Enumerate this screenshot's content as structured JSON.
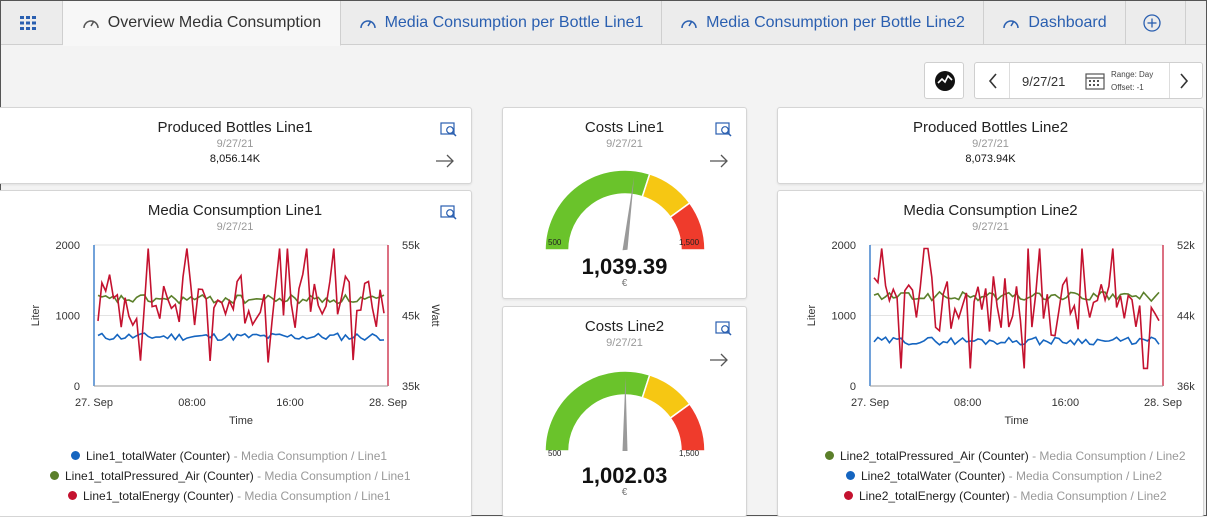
{
  "tabs": [
    {
      "label": ""
    },
    {
      "label": "Overview Media Consumption"
    },
    {
      "label": "Media Consumption per Bottle Line1"
    },
    {
      "label": "Media Consumption per Bottle Line2"
    },
    {
      "label": "Dashboard"
    },
    {
      "label": ""
    }
  ],
  "toolbar": {
    "date": "9/27/21",
    "range": "Range: Day",
    "offset": "Offset: -1"
  },
  "kpi1": {
    "title": "Produced Bottles Line1",
    "date": "9/27/21",
    "value": "8,056.14K"
  },
  "kpi2": {
    "title": "Produced Bottles Line2",
    "date": "9/27/21",
    "value": "8,073.94K"
  },
  "gauge1": {
    "title": "Costs Line1",
    "date": "9/27/21",
    "min": "500",
    "max": "1,500",
    "value": "1,039.39",
    "unit": "€",
    "reading": 1039.39
  },
  "gauge2": {
    "title": "Costs Line2",
    "date": "9/27/21",
    "min": "500",
    "max": "1,500",
    "value": "1,002.03",
    "unit": "€",
    "reading": 1002.03
  },
  "chart1": {
    "title": "Media Consumption Line1",
    "date": "9/27/21",
    "y_left_label": "Liter",
    "y_right_label": "Watt",
    "x_label": "Time",
    "left_ticks": [
      "2000",
      "1000",
      "0"
    ],
    "right_ticks": [
      "55k",
      "45k",
      "35k"
    ],
    "x_ticks": [
      "27. Sep",
      "08:00",
      "16:00",
      "28. Sep"
    ],
    "legend": [
      {
        "name": "Line1_totalWater (Counter)",
        "src": " - Media Consumption / Line1",
        "color": "#1565c0"
      },
      {
        "name": "Line1_totalPressured_Air (Counter)",
        "src": " - Media Consumption / Line1",
        "color": "#5b7f2a"
      },
      {
        "name": "Line1_totalEnergy (Counter)",
        "src": " - Media Consumption / Line1",
        "color": "#c4122f"
      }
    ]
  },
  "chart2": {
    "title": "Media Consumption Line2",
    "date": "9/27/21",
    "y_left_label": "Liter",
    "x_label": "Time",
    "left_ticks": [
      "2000",
      "1000",
      "0"
    ],
    "right_ticks": [
      "52k",
      "44k",
      "36k"
    ],
    "x_ticks": [
      "27. Sep",
      "08:00",
      "16:00",
      "28. Sep"
    ],
    "legend": [
      {
        "name": "Line2_totalPressured_Air (Counter)",
        "src": " - Media Consumption / Line2",
        "color": "#5b7f2a"
      },
      {
        "name": "Line2_totalWater (Counter)",
        "src": " - Media Consumption / Line2",
        "color": "#1565c0"
      },
      {
        "name": "Line2_totalEnergy (Counter)",
        "src": " - Media Consumption / Line2",
        "color": "#c4122f"
      }
    ]
  },
  "chart_data": [
    {
      "type": "line",
      "title": "Media Consumption Line1",
      "xlabel": "Time",
      "ylabel": "Liter",
      "ylim": [
        0,
        2000
      ],
      "y2label": "Watt",
      "y2lim": [
        "35k",
        "55k"
      ],
      "x": [
        "27. Sep",
        "08:00",
        "16:00",
        "28. Sep"
      ],
      "series": [
        {
          "name": "Line1_totalWater (Counter)",
          "axis": "left",
          "approx_level": 700
        },
        {
          "name": "Line1_totalPressured_Air (Counter)",
          "axis": "left",
          "approx_level": 1220
        },
        {
          "name": "Line1_totalEnergy (Counter)",
          "axis": "right",
          "approx_range": [
            "41k",
            "49k"
          ]
        }
      ]
    },
    {
      "type": "line",
      "title": "Media Consumption Line2",
      "xlabel": "Time",
      "ylabel": "Liter",
      "ylim": [
        0,
        2000
      ],
      "y2lim": [
        "36k",
        "52k"
      ],
      "x": [
        "27. Sep",
        "08:00",
        "16:00",
        "28. Sep"
      ],
      "series": [
        {
          "name": "Line2_totalPressured_Air (Counter)",
          "axis": "left",
          "approx_level": 1270
        },
        {
          "name": "Line2_totalWater (Counter)",
          "axis": "left",
          "approx_level": 650
        },
        {
          "name": "Line2_totalEnergy (Counter)",
          "axis": "right",
          "approx_range": [
            "39k",
            "50k"
          ]
        }
      ]
    }
  ]
}
